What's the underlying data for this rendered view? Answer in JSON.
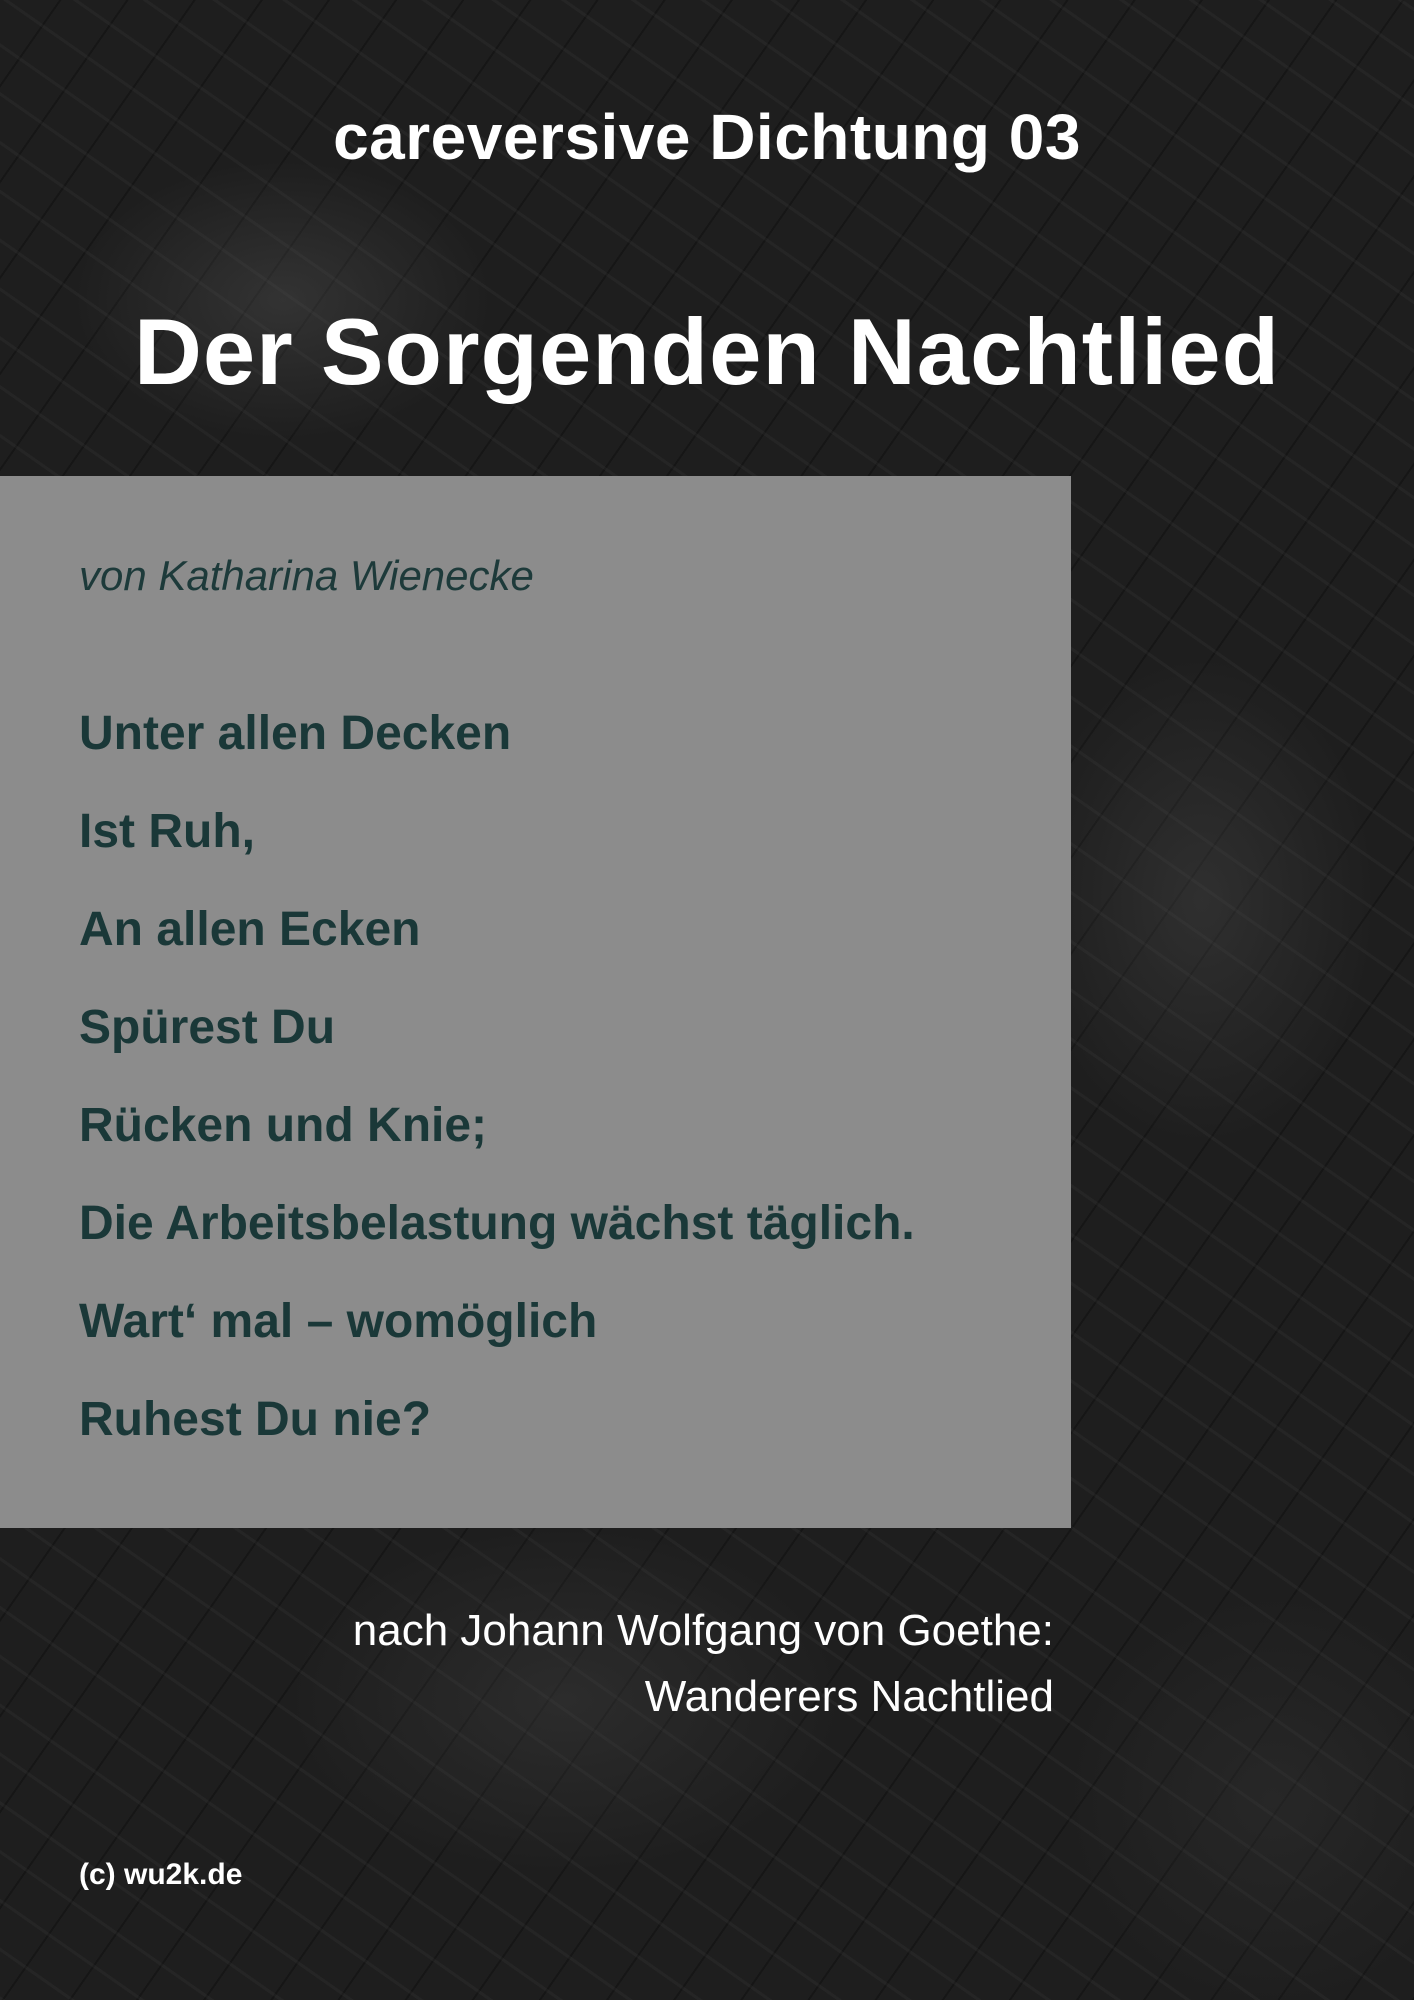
{
  "series_title": "careversive Dichtung 03",
  "title": "Der Sorgenden Nachtlied",
  "author": "von Katharina Wienecke",
  "poem_lines": [
    "Unter allen Decken",
    "Ist Ruh,",
    "An allen Ecken",
    "Spürest Du",
    "Rücken und Knie;",
    "Die Arbeitsbelastung wächst täglich.",
    "Wart‘ mal – womöglich",
    "Ruhest Du nie?"
  ],
  "attribution": [
    "nach Johann Wolfgang von Goethe:",
    "Wanderers Nachtlied"
  ],
  "copyright": "(c) wu2k.de",
  "colors": {
    "panel": "#8c8c8c",
    "poem_text": "#1a3838",
    "background": "#1e1e1e"
  }
}
